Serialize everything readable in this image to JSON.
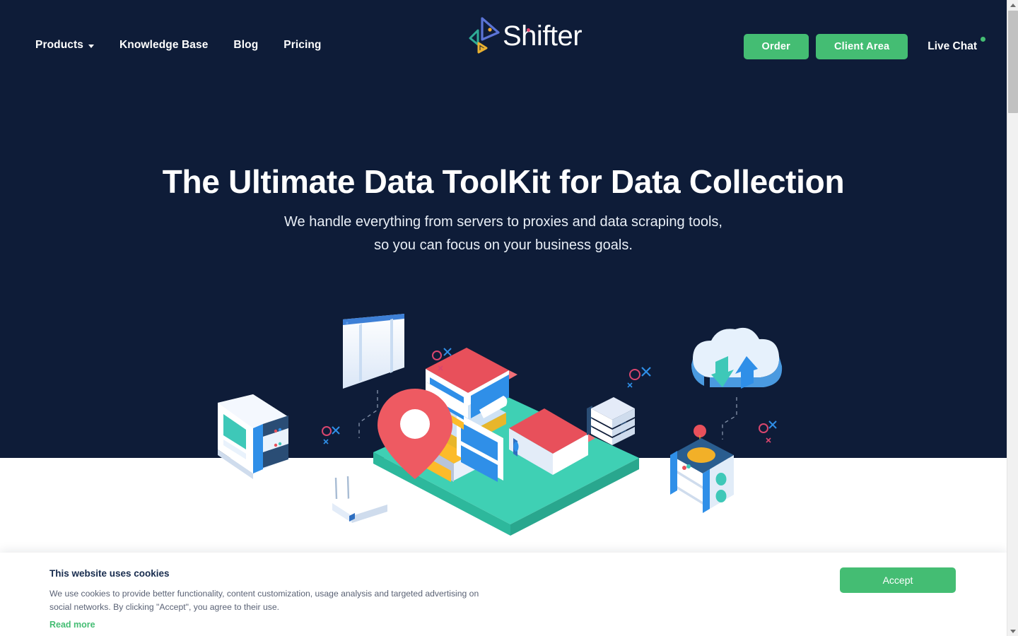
{
  "nav": {
    "items": [
      {
        "label": "Products",
        "has_dropdown": true,
        "icon": "chevron-down-icon"
      },
      {
        "label": "Knowledge Base",
        "has_dropdown": false
      },
      {
        "label": "Blog",
        "has_dropdown": false
      },
      {
        "label": "Pricing",
        "has_dropdown": false
      }
    ],
    "logo_text": "Shifter",
    "order_label": "Order",
    "client_area_label": "Client Area",
    "live_chat_label": "Live Chat",
    "live_chat_status": "online"
  },
  "hero": {
    "title": "The Ultimate Data ToolKit for Data Collection",
    "subtitle_line1": "We handle everything from servers to proxies and data scraping tools,",
    "subtitle_line2": "so you can focus on your business goals.",
    "illustration_alt": "isometric-data-infrastructure-illustration"
  },
  "cookie": {
    "title": "This website uses cookies",
    "body": "We use cookies to provide better functionality, content customization, usage analysis and targeted advertising on social networks. By clicking \"Accept\", you agree to their use.",
    "link_label": "Read more",
    "accept_label": "Accept"
  },
  "colors": {
    "hero_background": "#0e1c38",
    "accent_green": "#44bd73",
    "text_light": "#ffffff",
    "cookie_title": "#172b4d",
    "cookie_body": "#5a6275",
    "illus_teal": "#3fd0b4",
    "illus_red": "#e8505b",
    "illus_blue": "#2f8fe8",
    "illus_yellow": "#fcbb2a"
  },
  "scrollbar": {
    "up_icon": "scroll-up-arrow-icon",
    "down_icon": "scroll-down-arrow-icon"
  }
}
